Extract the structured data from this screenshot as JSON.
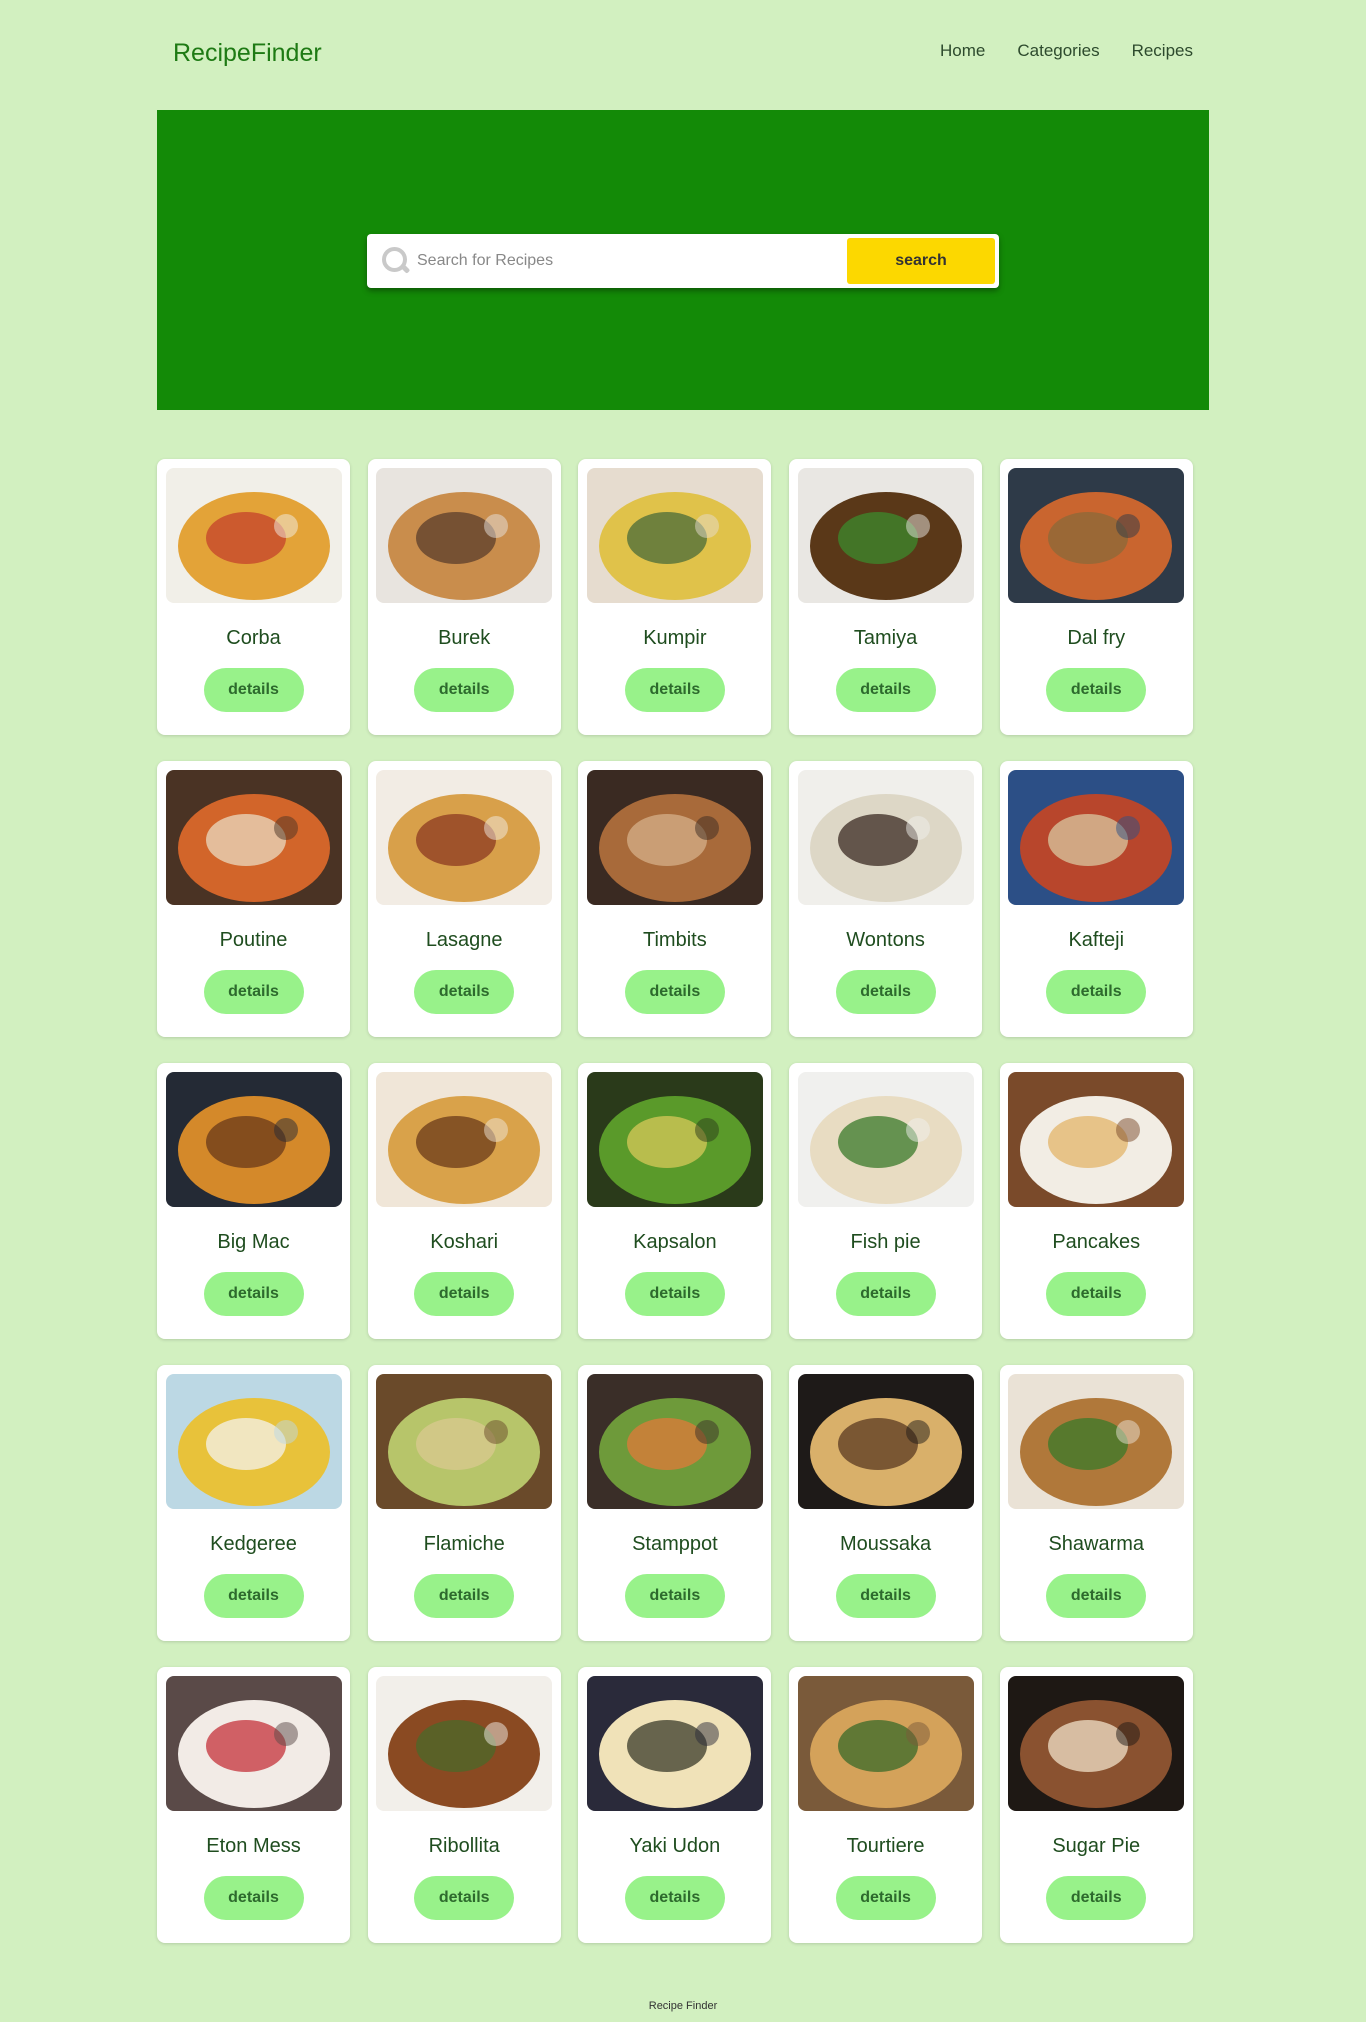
{
  "nav": {
    "logo": "RecipeFinder",
    "links": [
      "Home",
      "Categories",
      "Recipes"
    ]
  },
  "hero": {
    "search_placeholder": "Search for Recipes",
    "search_button": "search"
  },
  "recipes": [
    {
      "name": "Corba",
      "button": "details",
      "palette": [
        "#f1efe8",
        "#e3a338",
        "#c4422b"
      ]
    },
    {
      "name": "Burek",
      "button": "details",
      "palette": [
        "#e8e4df",
        "#c98d4c",
        "#5a3e2b"
      ]
    },
    {
      "name": "Kumpir",
      "button": "details",
      "palette": [
        "#e6dccf",
        "#e0c24a",
        "#4a6b3a"
      ]
    },
    {
      "name": "Tamiya",
      "button": "details",
      "palette": [
        "#e9e7e3",
        "#5a3818",
        "#3c8a2c"
      ]
    },
    {
      "name": "Dal fry",
      "button": "details",
      "palette": [
        "#2e3a48",
        "#c9652f",
        "#8a6a3a"
      ]
    },
    {
      "name": "Poutine",
      "button": "details",
      "palette": [
        "#4a3324",
        "#d2652a",
        "#eadbc2"
      ]
    },
    {
      "name": "Lasagne",
      "button": "details",
      "palette": [
        "#f2ece4",
        "#d8a04a",
        "#8c3a22"
      ]
    },
    {
      "name": "Timbits",
      "button": "details",
      "palette": [
        "#3a2a22",
        "#a86a3a",
        "#d6b08a"
      ]
    },
    {
      "name": "Wontons",
      "button": "details",
      "palette": [
        "#f0efeb",
        "#ddd7c6",
        "#3a2a22"
      ]
    },
    {
      "name": "Kafteji",
      "button": "details",
      "palette": [
        "#2c4f86",
        "#b8462c",
        "#d9c8a0"
      ]
    },
    {
      "name": "Big Mac",
      "button": "details",
      "palette": [
        "#242a35",
        "#d4892a",
        "#6a3a1a"
      ]
    },
    {
      "name": "Koshari",
      "button": "details",
      "palette": [
        "#f0e6d8",
        "#d9a24a",
        "#6a3a1a"
      ]
    },
    {
      "name": "Kapsalon",
      "button": "details",
      "palette": [
        "#2a3a1a",
        "#5a9a2a",
        "#d8c85a"
      ]
    },
    {
      "name": "Fish pie",
      "button": "details",
      "palette": [
        "#f0f0ee",
        "#e8dcc2",
        "#3a7a2a"
      ]
    },
    {
      "name": "Pancakes",
      "button": "details",
      "palette": [
        "#7a4a2a",
        "#f2ede4",
        "#e3b46a"
      ]
    },
    {
      "name": "Kedgeree",
      "button": "details",
      "palette": [
        "#bcd8e4",
        "#e8c23a",
        "#f4f2ee"
      ]
    },
    {
      "name": "Flamiche",
      "button": "details",
      "palette": [
        "#6a4a2a",
        "#b7c56a",
        "#d9c890"
      ]
    },
    {
      "name": "Stamppot",
      "button": "details",
      "palette": [
        "#3a2e28",
        "#6e9a3a",
        "#e07a3a"
      ]
    },
    {
      "name": "Moussaka",
      "button": "details",
      "palette": [
        "#1e1a18",
        "#d9b06a",
        "#5a3a22"
      ]
    },
    {
      "name": "Shawarma",
      "button": "details",
      "palette": [
        "#eae2d6",
        "#b0783a",
        "#3a7a2a"
      ]
    },
    {
      "name": "Eton Mess",
      "button": "details",
      "palette": [
        "#5a4a48",
        "#f2ebe6",
        "#c4323a"
      ]
    },
    {
      "name": "Ribollita",
      "button": "details",
      "palette": [
        "#f2efea",
        "#8a4a22",
        "#4a6a2a"
      ]
    },
    {
      "name": "Yaki Udon",
      "button": "details",
      "palette": [
        "#2a2a3a",
        "#f0e2b8",
        "#3a3a2a"
      ]
    },
    {
      "name": "Tourtiere",
      "button": "details",
      "palette": [
        "#7a5a3a",
        "#d4a25a",
        "#3a6a2a"
      ]
    },
    {
      "name": "Sugar Pie",
      "button": "details",
      "palette": [
        "#1e1814",
        "#8a5230",
        "#f0e2c8"
      ]
    }
  ],
  "footer": {
    "text": "Recipe Finder"
  }
}
